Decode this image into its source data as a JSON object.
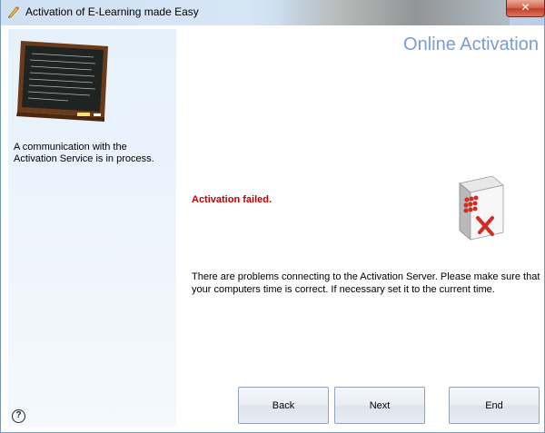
{
  "window": {
    "title": "Activation of E-Learning made Easy",
    "close_label": "✕"
  },
  "left_panel": {
    "status_text": "A communication with the Activation Service is in process.",
    "help_label": "?"
  },
  "main": {
    "heading": "Online Activation",
    "result": "Activation failed.",
    "message": "There are problems connecting to the Activation Server. Please make sure that your computers time is correct. If necessary set it to the current time."
  },
  "buttons": {
    "back": "Back",
    "next": "Next",
    "end": "End"
  },
  "colors": {
    "heading": "#7b9bd1",
    "error": "#c00000",
    "panel": "#e6f1fb"
  },
  "icons": {
    "title": "pencil-icon",
    "board": "chalkboard-icon",
    "server": "server-error-icon",
    "help": "help-icon"
  }
}
